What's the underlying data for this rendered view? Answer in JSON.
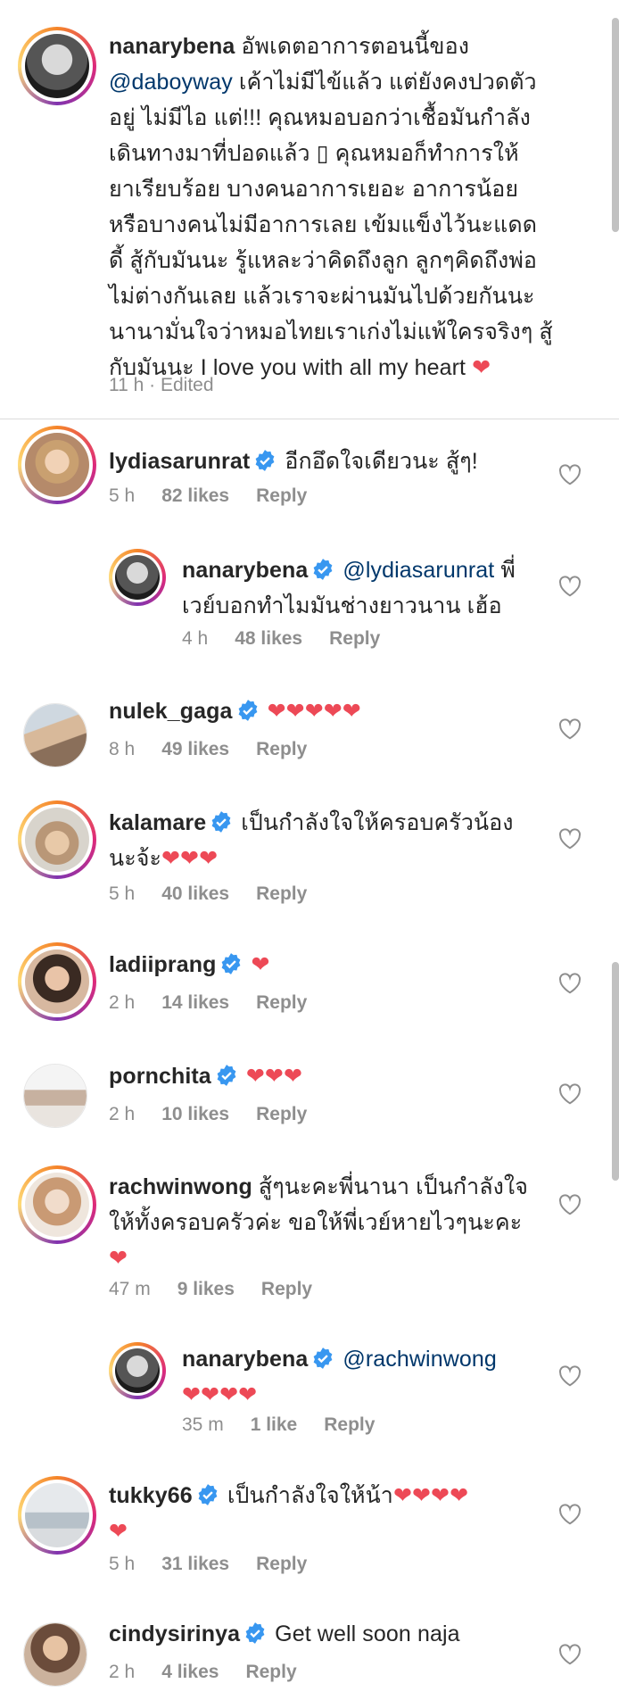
{
  "caption": {
    "username": "nanarybena",
    "lines": [
      " อัพเดตอาการตอนนี้ของ",
      " เค้าไม่มีไข้แล้ว แต่ยังคงปวดตัว",
      "อยู่ ไม่มีไอ แต่!!! คุณหมอบอกว่าเชื้อมันกำลัง",
      "เดินทางมาที่ปอดแล้ว ▯ คุณหมอก็ทำการให้",
      "ยาเรียบร้อย บางคนอาการเยอะ อาการน้อย",
      "หรือบางคนไม่มีอาการเลย เข้มแข็งไว้นะแดด",
      "ดี้ สู้กับมันนะ รู้แหละว่าคิดถึงลูก ลูกๆคิดถึงพ่อ",
      "ไม่ต่างกันเลย แล้วเราจะผ่านมันไปด้วยกันนะ",
      "นานามั่นใจว่าหมอไทยเราเก่งไม่แพ้ใครจริงๆ สู้",
      "กับมันนะ I love you with all my heart "
    ],
    "mention": "@daboyway",
    "heart": "❤",
    "time": "11 h · Edited"
  },
  "comments": [
    {
      "username": "lydiasarunrat",
      "text": "อีกอึดใจเดียวนะ สู้ๆ!",
      "time": "5 h",
      "likes": "82 likes",
      "reply": "Reply"
    },
    {
      "username": "nanarybena",
      "mention": "@lydiasarunrat",
      "text1": " พี่",
      "text2": "เวย์บอกทำไมมันช่างยาวนาน เฮ้อ",
      "time": "4 h",
      "likes": "48 likes",
      "reply": "Reply"
    },
    {
      "username": "nulek_gaga",
      "text": "❤❤❤❤❤",
      "time": "8 h",
      "likes": "49 likes",
      "reply": "Reply"
    },
    {
      "username": "kalamare",
      "text1": "เป็นกำลังใจให้ครอบครัวน้อง",
      "text2": "นะจ้ะ",
      "hearts": "❤❤❤",
      "time": "5 h",
      "likes": "40 likes",
      "reply": "Reply"
    },
    {
      "username": "ladiiprang",
      "text": "❤",
      "time": "2 h",
      "likes": "14 likes",
      "reply": "Reply"
    },
    {
      "username": "pornchita",
      "text": "❤❤❤",
      "time": "2 h",
      "likes": "10 likes",
      "reply": "Reply"
    },
    {
      "username": "rachwinwong",
      "text1": " สู้ๆนะคะพี่นานา เป็นกำลังใจ",
      "text2": "ให้ทั้งครอบครัวค่ะ ขอให้พี่เวย์หายไวๆนะคะ",
      "hearts": "❤",
      "time": "47 m",
      "likes": "9 likes",
      "reply": "Reply"
    },
    {
      "username": "nanarybena",
      "mention": "@rachwinwong",
      "hearts": "❤❤❤❤",
      "time": "35 m",
      "likes": "1 like",
      "reply": "Reply"
    },
    {
      "username": "tukky66",
      "text1": "เป็นกำลังใจให้น้า",
      "hearts1": "❤❤❤❤",
      "hearts2": "❤",
      "time": "5 h",
      "likes": "31 likes",
      "reply": "Reply"
    },
    {
      "username": "cindysirinya",
      "text": "Get well soon naja",
      "time": "2 h",
      "likes": "4 likes",
      "reply": "Reply"
    }
  ],
  "colors": {
    "text": "#262626",
    "meta": "#8e8e8e",
    "mention": "#00376b",
    "heart": "#ed4956",
    "verified": "#3897f0"
  }
}
